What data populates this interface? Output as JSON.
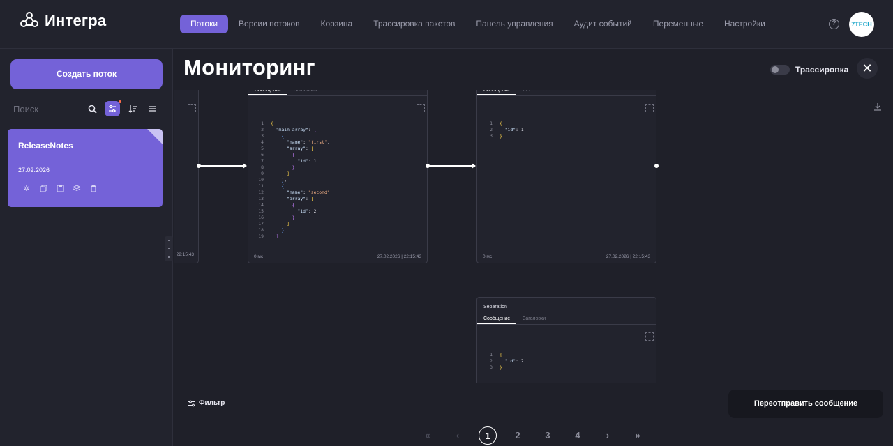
{
  "app": {
    "name": "Интегра"
  },
  "nav": {
    "items": [
      {
        "label": "Потоки",
        "active": true
      },
      {
        "label": "Версии потоков"
      },
      {
        "label": "Корзина"
      },
      {
        "label": "Трассировка пакетов"
      },
      {
        "label": "Панель управления"
      },
      {
        "label": "Аудит событий"
      },
      {
        "label": "Переменные"
      },
      {
        "label": "Настройки"
      }
    ],
    "help_icon": "question-circle-icon",
    "avatar_text": "7TECH"
  },
  "sidebar": {
    "create_label": "Создать поток",
    "search_placeholder": "Поиск",
    "flow": {
      "name": "ReleaseNotes",
      "date": "27.02.2026"
    }
  },
  "main": {
    "title": "Мониторинг",
    "trace_label": "Трассировка",
    "filter_label": "Фильтр",
    "resend_label": "Переотправить сообщение"
  },
  "nodes": {
    "left_partial_time": "22:15:43",
    "middle": {
      "tab_message": "Сообщение",
      "tab_headers": "Заголовки",
      "duration": "0 мс",
      "timestamp": "27.02.2026 | 22:15:43"
    },
    "right": {
      "tab_message": "Сообщение",
      "duration": "0 мс",
      "timestamp": "27.02.2026 | 22:15:43"
    },
    "bottom": {
      "title": "Separation",
      "tab_message": "Сообщение",
      "tab_headers": "Заголовки"
    }
  },
  "pager": {
    "first": "«",
    "prev": "‹",
    "pages": [
      "1",
      "2",
      "3",
      "4"
    ],
    "next": "›",
    "last": "»",
    "current": "1"
  },
  "colors": {
    "accent": "#7462d8",
    "background": "#1f2029",
    "panel": "#22232d"
  }
}
